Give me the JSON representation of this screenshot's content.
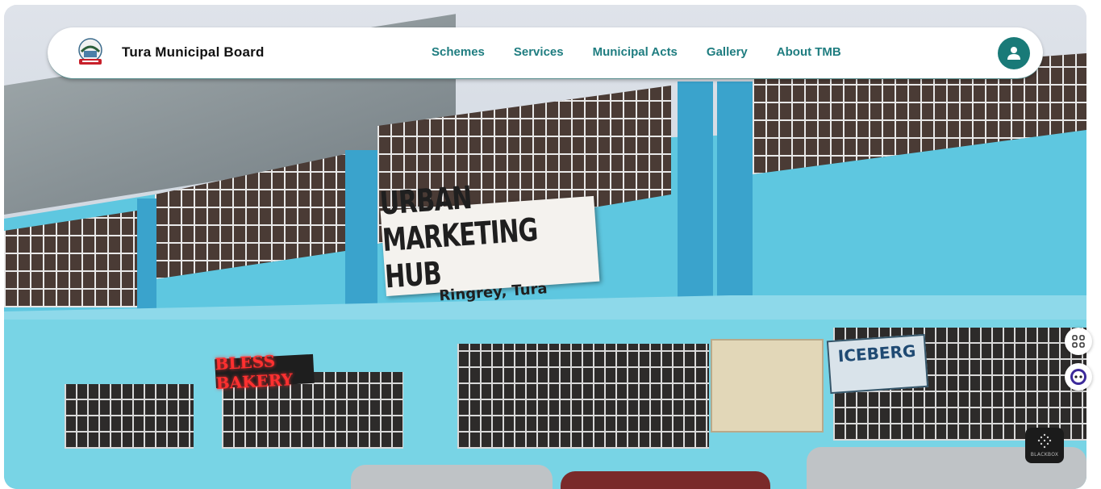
{
  "header": {
    "brand": "Tura Municipal Board",
    "nav": [
      "Schemes",
      "Services",
      "Municipal Acts",
      "Gallery",
      "About TMB"
    ]
  },
  "hero": {
    "signs": {
      "main_title": "URBAN MARKETING HUB",
      "main_subtitle": "Ringrey, Tura",
      "bakery": "BLESS BAKERY",
      "iceberg": "ICEBERG"
    }
  },
  "widgets": {
    "blackbox_label": "BLACKBOX"
  },
  "colors": {
    "accent": "#1f7d80",
    "user_button": "#197a78",
    "building_blue": "#5ec7e0"
  }
}
